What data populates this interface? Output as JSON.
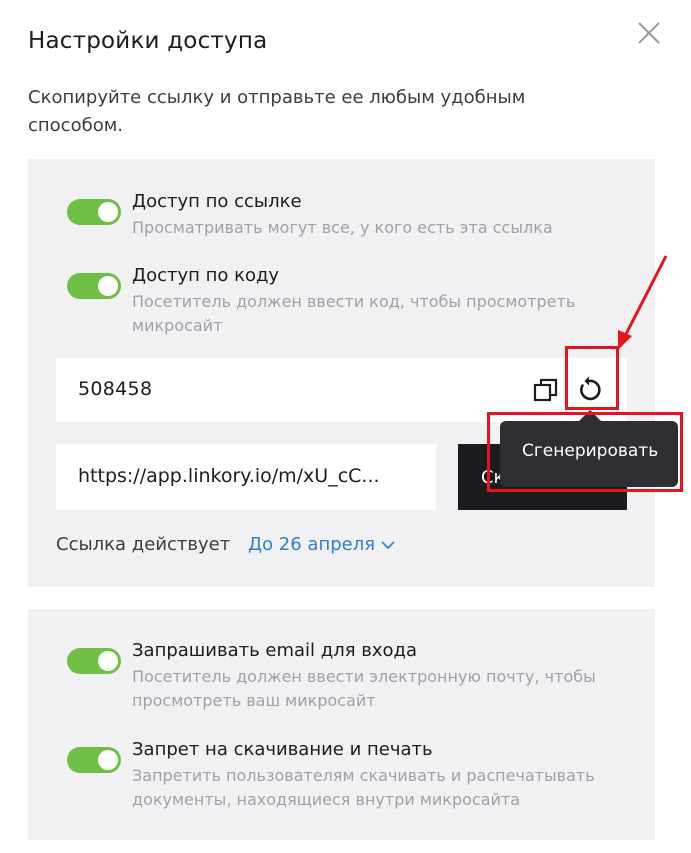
{
  "dialog": {
    "title": "Настройки доступа",
    "subtitle": "Скопируйте ссылку и отправьте ее любым удобным способом.",
    "close_icon": "close-icon"
  },
  "access": {
    "link_access": {
      "label": "Доступ по ссылке",
      "description": "Просматривать могут все, у кого есть эта ссылка",
      "enabled": true
    },
    "code_access": {
      "label": "Доступ по коду",
      "description": "Посетитель должен ввести код, чтобы просмотреть микросайт",
      "enabled": true
    },
    "code_value": "508458",
    "link_value": "https://app.linkory.io/m/xU_cC...",
    "copy_button_label": "Скопировать",
    "validity_label": "Ссылка действует",
    "validity_value": "До 26 апреля",
    "tooltip": "Сгенерировать"
  },
  "security": {
    "email_required": {
      "label": "Запрашивать email для входа",
      "description": "Посетитель должен ввести электронную почту, чтобы просмотреть ваш микросайт",
      "enabled": true
    },
    "no_download": {
      "label": "Запрет на скачивание и печать",
      "description": "Запретить пользователям скачивать и распечатывать документы, находящиеся внутри микросайта",
      "enabled": true
    }
  },
  "colors": {
    "toggle_on": "#6fbf44",
    "link_blue": "#2d7ed6",
    "button_dark": "#1b1c20",
    "annotation_red": "#e8131c"
  }
}
